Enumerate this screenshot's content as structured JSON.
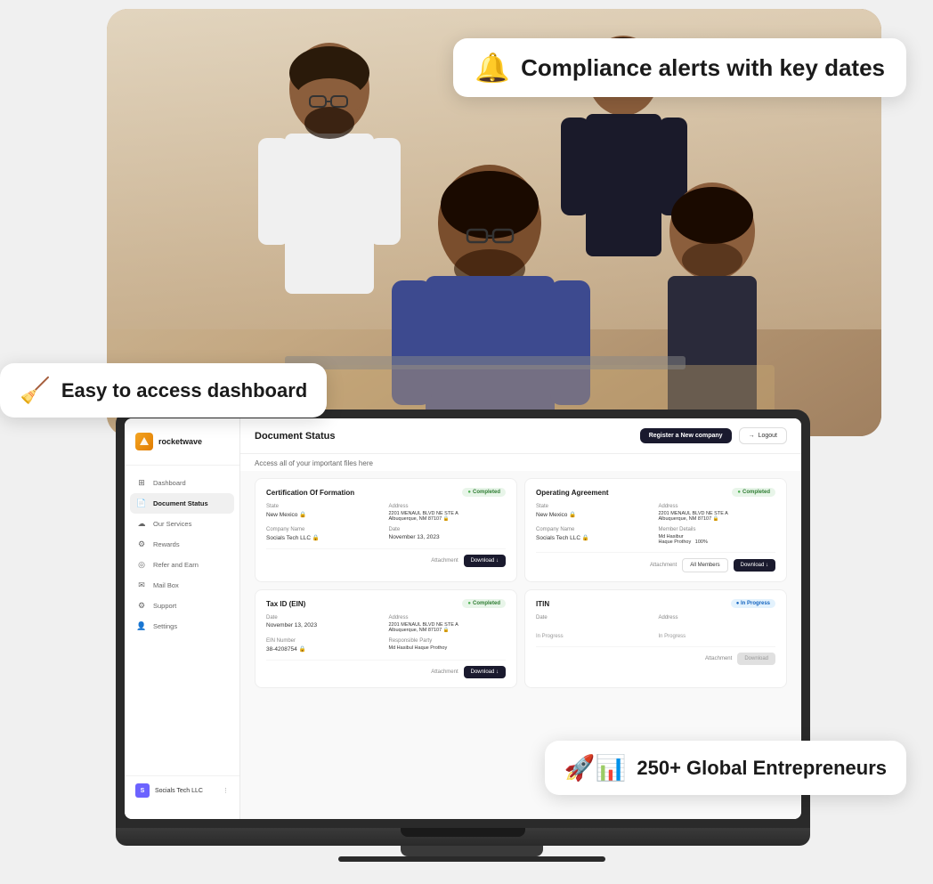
{
  "page": {
    "background": "#f0f0f0"
  },
  "compliance_badge": {
    "emoji": "🔔",
    "text": "Compliance alerts with key dates"
  },
  "dashboard_badge": {
    "emoji": "🧹",
    "text": "Easy to access dashboard"
  },
  "entrepreneurs_badge": {
    "emoji": "🚀📊",
    "text": "250+ Global Entrepreneurs"
  },
  "app": {
    "logo_text": "rocketwave",
    "header": {
      "title": "Document Status",
      "subtitle": "Access all of your important files here",
      "btn_register": "Register a New company",
      "btn_logout": "Logout"
    },
    "sidebar": {
      "items": [
        {
          "label": "Dashboard",
          "icon": "⊞",
          "active": false
        },
        {
          "label": "Document Status",
          "icon": "📄",
          "active": true
        },
        {
          "label": "Our Services",
          "icon": "☁",
          "active": false
        },
        {
          "label": "Rewards",
          "icon": "⚙",
          "active": false
        },
        {
          "label": "Refer and Earn",
          "icon": "◎",
          "active": false
        },
        {
          "label": "Mail Box",
          "icon": "✉",
          "active": false
        },
        {
          "label": "Support",
          "icon": "⚙",
          "active": false
        },
        {
          "label": "Settings",
          "icon": "👤",
          "active": false
        }
      ],
      "company": {
        "name": "Socials Tech LLC",
        "initials": "S"
      }
    },
    "documents": [
      {
        "title": "Certification Of Formation",
        "status": "Completed",
        "status_type": "completed",
        "fields": [
          {
            "label": "State",
            "value": "New Mexico"
          },
          {
            "label": "Address",
            "value": "2201 MENAUL BLVD NE STE A Albuquerque, NM 87107"
          }
        ],
        "fields2": [
          {
            "label": "Company Name",
            "value": "Socials Tech LLC"
          },
          {
            "label": "Date",
            "value": "November 13, 2023"
          }
        ],
        "attachment_label": "Attachment",
        "btn_download": "Download ↓",
        "has_all_members": false
      },
      {
        "title": "Operating Agreement",
        "status": "Completed",
        "status_type": "completed",
        "fields": [
          {
            "label": "State",
            "value": "New Mexico"
          },
          {
            "label": "Address",
            "value": "2201 MENAUL BLVD NE STE A Albuquerque, NM 87107"
          }
        ],
        "fields2": [
          {
            "label": "Company Name",
            "value": "Socials Tech LLC"
          },
          {
            "label": "Member Details",
            "value": "Md Hasibur Haque Prothoy  100%"
          }
        ],
        "attachment_label": "Attachment",
        "btn_all_members": "All Members",
        "btn_download": "Download ↓",
        "has_all_members": true
      },
      {
        "title": "Tax ID (EIN)",
        "status": "Completed",
        "status_type": "completed",
        "fields": [
          {
            "label": "Date",
            "value": "November 13, 2023"
          },
          {
            "label": "Address",
            "value": "2201 MENAUL BLVD NE STE A Albuquerque, NM 87107"
          }
        ],
        "fields2": [
          {
            "label": "EIN Number",
            "value": "38-4208754"
          },
          {
            "label": "Responsible Party",
            "value": "Md Hasibul Haque Prothoy"
          }
        ],
        "attachment_label": "Attachment",
        "btn_download": "Download ↓",
        "has_all_members": false
      },
      {
        "title": "ITIN",
        "status": "In Progress",
        "status_type": "inprogress",
        "fields": [
          {
            "label": "Date",
            "value": ""
          },
          {
            "label": "Address",
            "value": ""
          }
        ],
        "fields2": [
          {
            "label": "",
            "value": "In Progress"
          },
          {
            "label": "",
            "value": "In Progress"
          }
        ],
        "attachment_label": "Attachment",
        "btn_download": "Download",
        "btn_download_disabled": true,
        "has_all_members": false
      }
    ]
  }
}
